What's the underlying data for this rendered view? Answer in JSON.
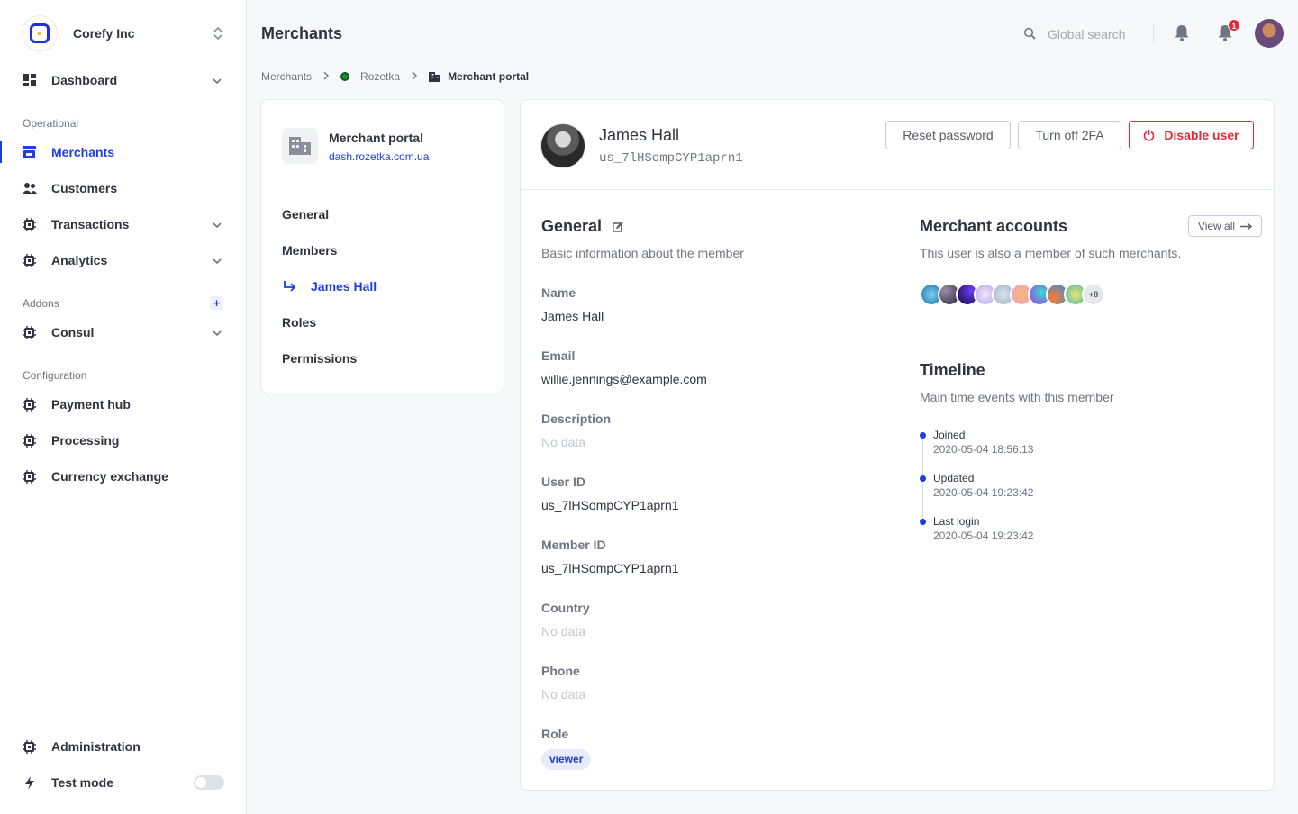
{
  "org": {
    "name": "Corefy Inc"
  },
  "nav": {
    "dashboard": "Dashboard",
    "operational_label": "Operational",
    "merchants": "Merchants",
    "customers": "Customers",
    "transactions": "Transactions",
    "analytics": "Analytics",
    "addons_label": "Addons",
    "consul": "Consul",
    "configuration_label": "Configuration",
    "payment_hub": "Payment hub",
    "processing": "Processing",
    "currency_exchange": "Currency exchange",
    "administration": "Administration",
    "test_mode": "Test mode",
    "test_mode_on": false
  },
  "header": {
    "title": "Merchants",
    "search_placeholder": "Global search",
    "notification_count": "1"
  },
  "breadcrumb": [
    "Merchants",
    "Rozetka",
    "Merchant portal"
  ],
  "portal": {
    "name": "Merchant portal",
    "url": "dash.rozetka.com.ua",
    "menu": [
      "General",
      "Members",
      "James Hall",
      "Roles",
      "Permissions"
    ]
  },
  "user": {
    "name": "James Hall",
    "id": "us_7lHSompCYP1aprn1",
    "actions": {
      "reset": "Reset password",
      "twofa": "Turn off 2FA",
      "disable": "Disable user"
    }
  },
  "general": {
    "title": "General",
    "subtitle": "Basic information about the member",
    "fields": [
      {
        "label": "Name",
        "value": "James Hall"
      },
      {
        "label": "Email",
        "value": "willie.jennings@example.com"
      },
      {
        "label": "Description",
        "value": "No data"
      },
      {
        "label": "User ID",
        "value": "us_7lHSompCYP1aprn1"
      },
      {
        "label": "Member ID",
        "value": "us_7lHSompCYP1aprn1"
      },
      {
        "label": "Country",
        "value": "No data"
      },
      {
        "label": "Phone",
        "value": "No data"
      },
      {
        "label": "Role",
        "value": "viewer"
      }
    ]
  },
  "merchant_accounts": {
    "title": "Merchant accounts",
    "subtitle": "This user is also a member of such merchants.",
    "view_all": "View all",
    "more": "+8"
  },
  "timeline": {
    "title": "Timeline",
    "subtitle": "Main time events with this member",
    "events": [
      {
        "label": "Joined",
        "date": "2020-05-04 18:56:13"
      },
      {
        "label": "Updated",
        "date": "2020-05-04 19:23:42"
      },
      {
        "label": "Last login",
        "date": "2020-05-04 19:23:42"
      }
    ]
  },
  "colors": {
    "accent": "#1f3ee0",
    "danger": "#e5293a"
  }
}
